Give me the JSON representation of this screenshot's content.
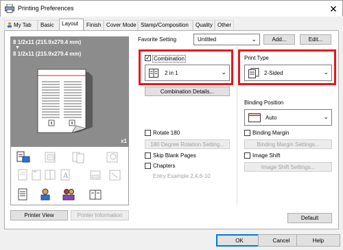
{
  "window": {
    "title": "Printing Preferences",
    "close_glyph": "✕"
  },
  "tabs": [
    {
      "label": "My Tab"
    },
    {
      "label": "Basic"
    },
    {
      "label": "Layout"
    },
    {
      "label": "Finish"
    },
    {
      "label": "Cover Mode"
    },
    {
      "label": "Stamp/Composition"
    },
    {
      "label": "Quality"
    },
    {
      "label": "Other"
    }
  ],
  "preview": {
    "paper_line1": "8 1/2x11 (215.9x279.4 mm)",
    "arrow": "▼",
    "paper_line2": "8 1/2x11 (215.9x279.4 mm)",
    "copies": "x1"
  },
  "preview_buttons": {
    "printer_view": "Printer View",
    "printer_information": "Printer Information"
  },
  "favorite": {
    "label": "Favorite Setting",
    "value": "Untitled",
    "add": "Add...",
    "edit": "Edit..."
  },
  "combination": {
    "label": "Combination",
    "checked": true,
    "value": "2 in 1",
    "details_button": "Combination Details..."
  },
  "print_type": {
    "label": "Print Type",
    "value": "2-Sided"
  },
  "binding_position": {
    "label": "Binding Position",
    "value": "Auto"
  },
  "rotate180": {
    "label": "Rotate 180",
    "checked": false,
    "settings_button": "180 Degree Rotation Setting..."
  },
  "skip_blank": {
    "label": "Skip Blank Pages",
    "checked": false
  },
  "chapters": {
    "label": "Chapters",
    "checked": false,
    "placeholder": "Entry Example 2,4,6-10"
  },
  "binding_margin": {
    "label": "Binding Margin",
    "checked": false,
    "settings_button": "Binding Margin Settings..."
  },
  "image_shift": {
    "label": "Image Shift",
    "checked": false,
    "settings_button": "Image Shift Settings..."
  },
  "default_button": "Default",
  "footer": {
    "ok": "OK",
    "cancel": "Cancel",
    "help": "Help"
  },
  "colors": {
    "highlight": "#e8141c",
    "preview_bg": "#8c8c8c"
  },
  "icons": [
    "printer-icon",
    "booklet-icon",
    "duplex-icon",
    "stamp-icon",
    "page-icon",
    "staple-icon",
    "text-icon",
    "tray-icon",
    "fold-icon",
    "user-icon",
    "user-group-icon",
    "book-icon"
  ]
}
